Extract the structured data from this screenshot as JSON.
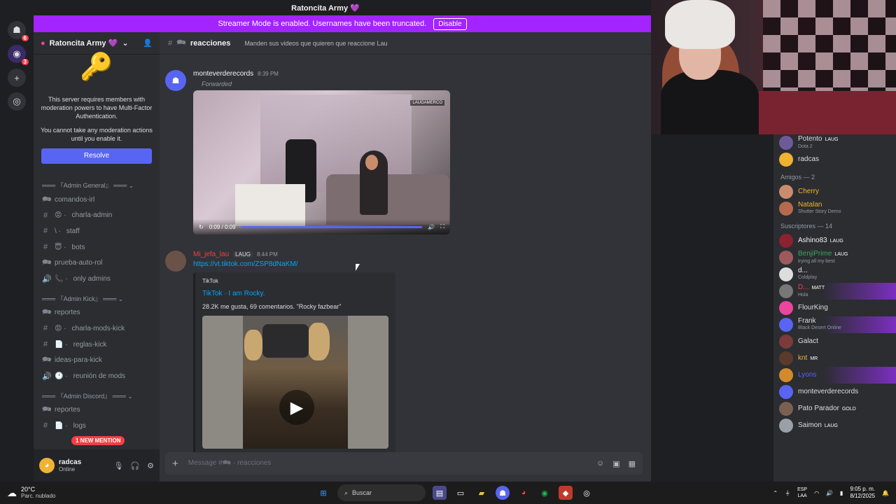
{
  "window": {
    "title": "Ratoncita Army 💜"
  },
  "banner": {
    "text": "Streamer Mode is enabled. Usernames have been truncated.",
    "button": "Disable"
  },
  "rail": {
    "badge1": "6",
    "badge2": "3"
  },
  "server": {
    "name": "Ratoncita Army 💜"
  },
  "mfa": {
    "line1": "This server requires members with moderation powers to have Multi-Factor Authentication.",
    "line2": "You cannot take any moderation actions until you enable it.",
    "button": "Resolve"
  },
  "categories": [
    {
      "name": "═══ 『Admin General』 ═══ ⌄",
      "channels": [
        {
          "icon": "🗪",
          "prefix": "",
          "name": "comandos-irl"
        },
        {
          "icon": "#",
          "prefix": "😡 ·",
          "name": "charla-admin"
        },
        {
          "icon": "#",
          "prefix": "\\ ·",
          "name": "staff"
        },
        {
          "icon": "#",
          "prefix": "😇 ·",
          "name": "bots"
        },
        {
          "icon": "🗪",
          "prefix": "",
          "name": "prueba-auto-rol"
        },
        {
          "icon": "🔊",
          "prefix": "📞 ·",
          "name": "only admins"
        }
      ]
    },
    {
      "name": "═══ 『Admin Kick』 ═══ ⌄",
      "channels": [
        {
          "icon": "🗪",
          "prefix": "",
          "name": "reportes"
        },
        {
          "icon": "#",
          "prefix": "😡 ·",
          "name": "charla-mods-kick"
        },
        {
          "icon": "#",
          "prefix": "📄 ·",
          "name": "reglas-kick"
        },
        {
          "icon": "🗪",
          "prefix": "",
          "name": "ideas-para-kick"
        },
        {
          "icon": "🔊",
          "prefix": "🕐 ·",
          "name": "reunión de mods"
        }
      ]
    },
    {
      "name": "═══ 『Admin Discord』 ═══ ⌄",
      "channels": [
        {
          "icon": "🗪",
          "prefix": "",
          "name": "reportes"
        },
        {
          "icon": "#",
          "prefix": "📄 ·",
          "name": "logs"
        }
      ]
    }
  ],
  "mention_pill": "1 NEW MENTION",
  "user": {
    "name": "radcas",
    "status": "Online"
  },
  "channel": {
    "name": "reacciones",
    "topic": "Manden sus videos que quieren que reaccione Lau"
  },
  "messages": [
    {
      "author": "monteverderecords",
      "time": "8:39 PM",
      "forwarded": "Forwarded",
      "video_time": "0:09 / 0:09",
      "video_progress": 1.0,
      "watermark": "LAUGAMERCO"
    },
    {
      "author": "Mi_jefa_lau",
      "tag": "LAUG",
      "time": "8:44 PM",
      "link": "https://vt.tiktok.com/ZSP8dNaKM/",
      "embed": {
        "provider": "TikTok",
        "title": "TikTok · I am Rocky.",
        "desc": "28.2K me gusta, 69 comentarios. \"Rocky fazbear\""
      }
    }
  ],
  "composer": {
    "placeholder": "Message #🗪 · reacciones"
  },
  "members": [
    {
      "type": "member",
      "name": "Potento",
      "tag": "LAUG",
      "sub": "Dota 2",
      "color": "#dbdee1",
      "av": "#6e5a9a"
    },
    {
      "type": "member",
      "name": "radcas",
      "sub": "",
      "color": "#dbdee1",
      "av": "#f0b232"
    },
    {
      "type": "group",
      "name": "Amigos — 2"
    },
    {
      "type": "member",
      "name": "Cherry",
      "sub": "",
      "color": "#f0b232",
      "av": "#c98d6e"
    },
    {
      "type": "member",
      "name": "Natalan",
      "sub": "Shutter Story Demo",
      "color": "#f0b232",
      "av": "#b56a4d"
    },
    {
      "type": "group",
      "name": "Suscriptores — 14"
    },
    {
      "type": "member",
      "name": "Ashino83",
      "tag": "LAUG",
      "sub": "",
      "color": "#f2f3f5",
      "av": "#8a2230"
    },
    {
      "type": "member",
      "name": "BenjiPrime",
      "tag": "LAUG",
      "sub": "trying all my best",
      "color": "#3ba55d",
      "av": "#9c5a5a"
    },
    {
      "type": "member",
      "name": "d...",
      "sub": "Coldplay",
      "color": "#f2f3f5",
      "av": "#dddddd"
    },
    {
      "type": "member",
      "name": "D...",
      "tag": "MATT",
      "sub": "Hola",
      "color": "#f23f43",
      "av": "#777777",
      "highlight": true
    },
    {
      "type": "member",
      "name": "FlourKing",
      "sub": "",
      "color": "#dbdee1",
      "av": "#eb459e"
    },
    {
      "type": "member",
      "name": "Frank",
      "sub": "Black Desert Online",
      "color": "#dbdee1",
      "av": "#5865f2",
      "highlight": true
    },
    {
      "type": "member",
      "name": "Galact",
      "sub": "",
      "color": "#dbdee1",
      "av": "#7a3b3b"
    },
    {
      "type": "member",
      "name": "knt",
      "tag": "MR",
      "sub": "",
      "color": "#f0b232",
      "av": "#5a3a2a"
    },
    {
      "type": "member",
      "name": "Lyons",
      "sub": "",
      "color": "#5865f2",
      "av": "#d18a2c",
      "highlight": true
    },
    {
      "type": "member",
      "name": "monteverderecords",
      "sub": "",
      "color": "#dbdee1",
      "av": "#5865f2"
    },
    {
      "type": "member",
      "name": "Pato Parador",
      "tag": "GOLD",
      "sub": "",
      "color": "#dbdee1",
      "av": "#7a6050"
    },
    {
      "type": "member",
      "name": "Saimon",
      "tag": "LAUG",
      "sub": "",
      "color": "#dbdee1",
      "av": "#9aa0a8"
    }
  ],
  "taskbar": {
    "temp": "20°C",
    "weather": "Parc. nublado",
    "search": "Buscar",
    "lang1": "ESP",
    "lang2": "LAA",
    "time": "9:05 p. m.",
    "date": "8/12/2025"
  }
}
